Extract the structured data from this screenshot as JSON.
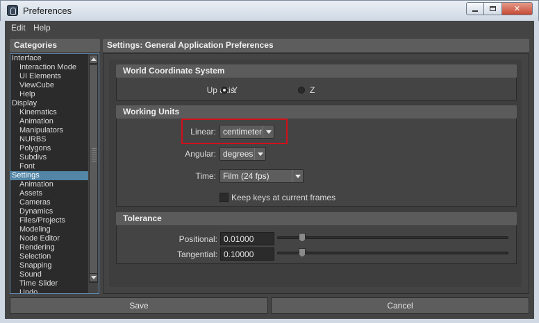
{
  "window": {
    "title": "Preferences"
  },
  "menu": {
    "items": [
      "Edit",
      "Help"
    ]
  },
  "categories": {
    "header": "Categories",
    "items": [
      {
        "label": "Interface",
        "level": 0
      },
      {
        "label": "Interaction Mode",
        "level": 1
      },
      {
        "label": "UI Elements",
        "level": 1
      },
      {
        "label": "ViewCube",
        "level": 1
      },
      {
        "label": "Help",
        "level": 1
      },
      {
        "label": "Display",
        "level": 0
      },
      {
        "label": "Kinematics",
        "level": 1
      },
      {
        "label": "Animation",
        "level": 1
      },
      {
        "label": "Manipulators",
        "level": 1
      },
      {
        "label": "NURBS",
        "level": 1
      },
      {
        "label": "Polygons",
        "level": 1
      },
      {
        "label": "Subdivs",
        "level": 1
      },
      {
        "label": "Font",
        "level": 1
      },
      {
        "label": "Settings",
        "level": 0,
        "selected": true
      },
      {
        "label": "Animation",
        "level": 1
      },
      {
        "label": "Assets",
        "level": 1
      },
      {
        "label": "Cameras",
        "level": 1
      },
      {
        "label": "Dynamics",
        "level": 1
      },
      {
        "label": "Files/Projects",
        "level": 1
      },
      {
        "label": "Modeling",
        "level": 1
      },
      {
        "label": "Node Editor",
        "level": 1
      },
      {
        "label": "Rendering",
        "level": 1
      },
      {
        "label": "Selection",
        "level": 1
      },
      {
        "label": "Snapping",
        "level": 1
      },
      {
        "label": "Sound",
        "level": 1
      },
      {
        "label": "Time Slider",
        "level": 1
      },
      {
        "label": "Undo",
        "level": 1
      }
    ]
  },
  "settings": {
    "header": "Settings: General Application Preferences",
    "world": {
      "title": "World Coordinate System",
      "up_axis_label": "Up axis:",
      "options": [
        "Y",
        "Z"
      ],
      "selected": "Y"
    },
    "units": {
      "title": "Working Units",
      "linear_label": "Linear:",
      "linear_value": "centimeter",
      "angular_label": "Angular:",
      "angular_value": "degrees",
      "time_label": "Time:",
      "time_value": "Film (24 fps)",
      "keep_keys_label": "Keep keys at current frames",
      "keep_keys_checked": false
    },
    "tolerance": {
      "title": "Tolerance",
      "positional_label": "Positional:",
      "positional_value": "0.01000",
      "tangential_label": "Tangential:",
      "tangential_value": "0.10000"
    }
  },
  "buttons": {
    "save": "Save",
    "cancel": "Cancel"
  },
  "colors": {
    "highlight_box": "#d0101a",
    "selection": "#5285a6"
  }
}
